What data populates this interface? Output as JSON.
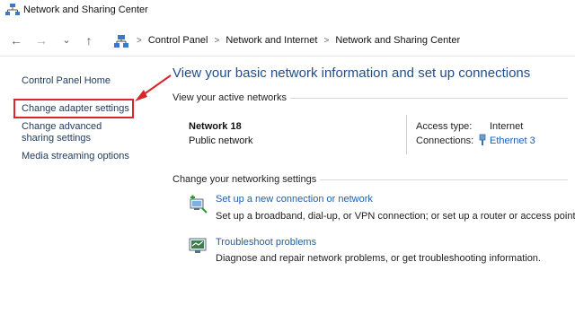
{
  "window": {
    "title": "Network and Sharing Center",
    "icon": "network-sharing-center-icon"
  },
  "nav": {
    "back": "←",
    "forward": "→",
    "recent": "⌄",
    "up": "↑"
  },
  "breadcrumb": [
    "Control Panel",
    "Network and Internet",
    "Network and Sharing Center"
  ],
  "sidebar": {
    "home": "Control Panel Home",
    "items": [
      {
        "label": "Change adapter settings"
      },
      {
        "label": "Change advanced sharing settings"
      },
      {
        "label": "Media streaming options"
      }
    ]
  },
  "main": {
    "title": "View your basic network information and set up connections",
    "active_networks_label": "View your active networks",
    "network": {
      "name": "Network 18",
      "type": "Public network",
      "access_type_label": "Access type:",
      "access_type_value": "Internet",
      "connections_label": "Connections:",
      "connections_value": "Ethernet 3"
    },
    "change_settings_label": "Change your networking settings",
    "tasks": [
      {
        "link": "Set up a new connection or network",
        "desc": "Set up a broadband, dial-up, or VPN connection; or set up a router or access point.",
        "icon": "new-connection-icon"
      },
      {
        "link": "Troubleshoot problems",
        "desc": "Diagnose and repair network problems, or get troubleshooting information.",
        "icon": "troubleshoot-icon"
      }
    ]
  },
  "colors": {
    "link": "#1f5fad",
    "title": "#1f4e8c",
    "annotation": "#d9262b"
  }
}
